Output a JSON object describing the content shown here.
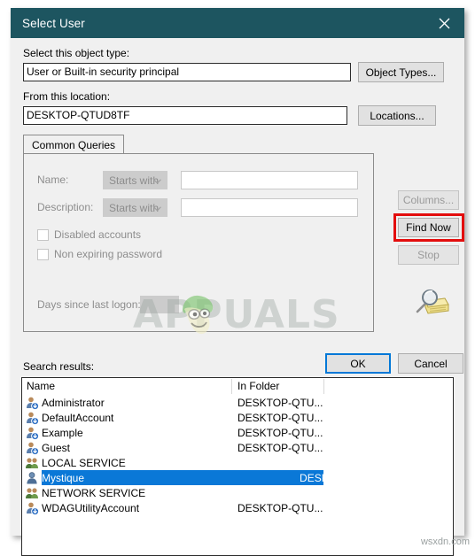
{
  "window": {
    "title": "Select User",
    "close_icon": "close-icon",
    "titlebar_color": "#1d5560"
  },
  "object_type": {
    "label": "Select this object type:",
    "value": "User or Built-in security principal",
    "button": "Object Types..."
  },
  "location": {
    "label": "From this location:",
    "value": "DESKTOP-QTUD8TF",
    "button": "Locations..."
  },
  "tabs": [
    {
      "label": "Common Queries",
      "active": true
    }
  ],
  "queries": {
    "name": {
      "label": "Name:",
      "operator": "Starts with",
      "value": "",
      "disabled": true
    },
    "description": {
      "label": "Description:",
      "operator": "Starts with",
      "value": "",
      "disabled": true
    },
    "checkboxes": [
      {
        "label": "Disabled accounts",
        "checked": false,
        "disabled": true
      },
      {
        "label": "Non expiring password",
        "checked": false,
        "disabled": true
      }
    ],
    "days_since_last_logon": {
      "label": "Days since last logon:",
      "value": "",
      "disabled": true
    }
  },
  "side_buttons": [
    {
      "label": "Columns...",
      "disabled": true,
      "highlighted": false
    },
    {
      "label": "Find Now",
      "disabled": false,
      "highlighted": true
    },
    {
      "label": "Stop",
      "disabled": true,
      "highlighted": false
    }
  ],
  "side_buttons_map": {
    "columns": "Columns...",
    "find_now": "Find Now",
    "stop": "Stop"
  },
  "search_icon": "search-folder-icon",
  "dialog_buttons": {
    "ok": "OK",
    "cancel": "Cancel"
  },
  "results": {
    "label": "Search results:",
    "columns": [
      "Name",
      "In Folder"
    ],
    "rows": [
      {
        "icon": "user-disabled-icon",
        "name": "Administrator",
        "folder": "DESKTOP-QTU...",
        "selected": false
      },
      {
        "icon": "user-disabled-icon",
        "name": "DefaultAccount",
        "folder": "DESKTOP-QTU...",
        "selected": false
      },
      {
        "icon": "user-disabled-icon",
        "name": "Example",
        "folder": "DESKTOP-QTU...",
        "selected": false
      },
      {
        "icon": "user-disabled-icon",
        "name": "Guest",
        "folder": "DESKTOP-QTU...",
        "selected": false
      },
      {
        "icon": "group-icon",
        "name": "LOCAL SERVICE",
        "folder": "",
        "selected": false
      },
      {
        "icon": "user-icon",
        "name": "Mystique",
        "folder": "DESKTOP-QTU...",
        "selected": true
      },
      {
        "icon": "group-icon",
        "name": "NETWORK SERVICE",
        "folder": "",
        "selected": false
      },
      {
        "icon": "user-disabled-icon",
        "name": "WDAGUtilityAccount",
        "folder": "DESKTOP-QTU...",
        "selected": false
      }
    ],
    "selection_color": "#0a78d7"
  },
  "watermarks": {
    "brand": "APPUALS",
    "site": "wsxdn.com"
  }
}
